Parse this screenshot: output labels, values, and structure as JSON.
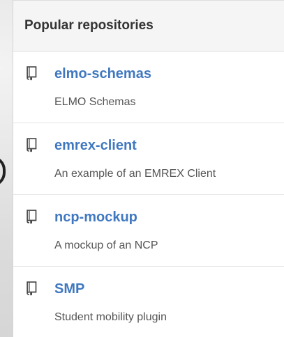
{
  "panel": {
    "title": "Popular repositories"
  },
  "repositories": [
    {
      "name": "elmo-schemas",
      "description": "ELMO Schemas",
      "icon": "repo-icon"
    },
    {
      "name": "emrex-client",
      "description": "An example of an EMREX Client",
      "icon": "repo-icon"
    },
    {
      "name": "ncp-mockup",
      "description": "A mockup of an NCP",
      "icon": "repo-icon"
    },
    {
      "name": "SMP",
      "description": "Student mobility plugin",
      "icon": "repo-icon"
    }
  ],
  "colors": {
    "link": "#4078c0",
    "header_bg": "#f5f5f5",
    "title_text": "#333333",
    "description_text": "#555555"
  }
}
